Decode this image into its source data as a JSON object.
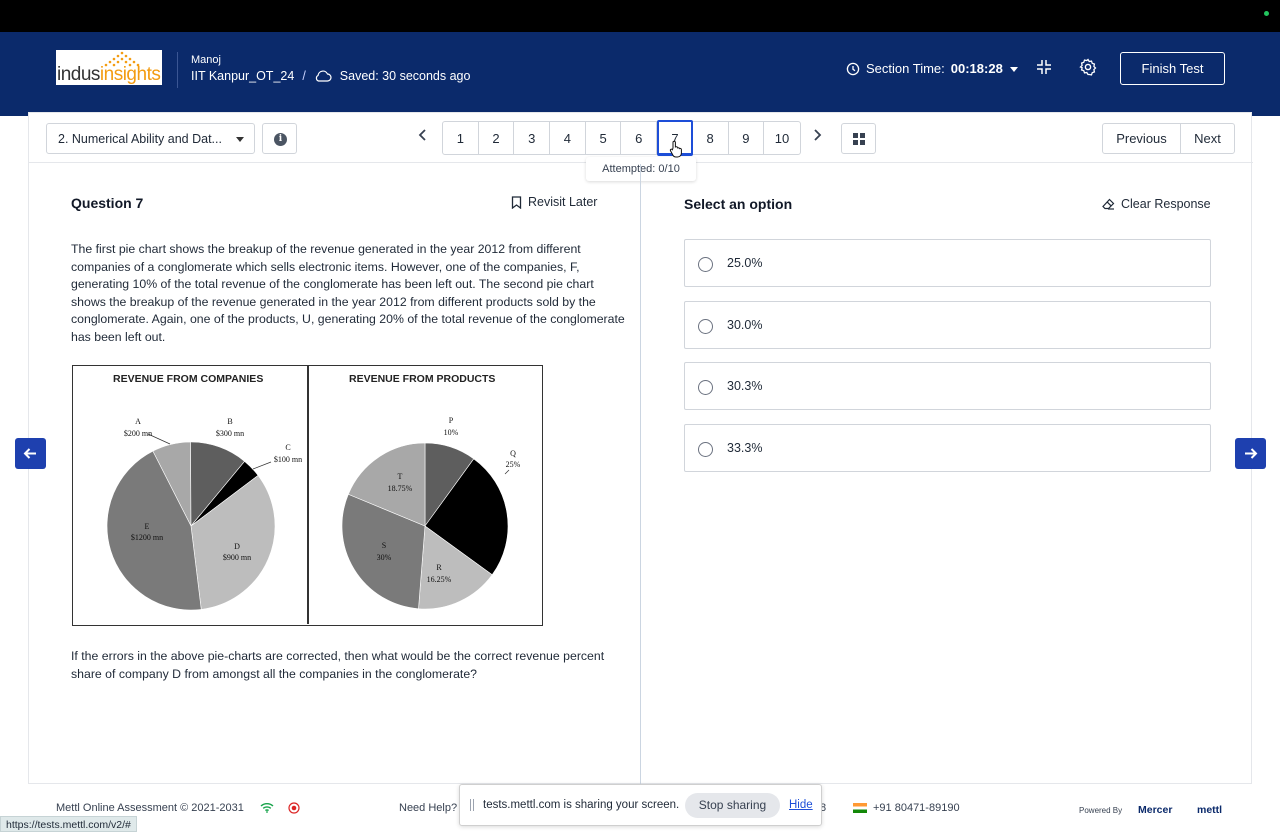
{
  "header": {
    "logo_text_a": "indus",
    "logo_text_b": "insights",
    "user_name": "Manoj",
    "test_name": "IIT Kanpur_OT_24",
    "separator": "/",
    "saved_status": "Saved: 30 seconds ago",
    "section_time_label": "Section Time:",
    "section_time_value": "00:18:28",
    "finish_label": "Finish Test"
  },
  "toolbar": {
    "section_select": "2. Numerical Ability and Dat...",
    "question_numbers": [
      "1",
      "2",
      "3",
      "4",
      "5",
      "6",
      "7",
      "8",
      "9",
      "10"
    ],
    "active_question": "7",
    "attempted": "Attempted: 0/10",
    "previous_label": "Previous",
    "next_label": "Next"
  },
  "question": {
    "title": "Question 7",
    "revisit_label": "Revisit Later",
    "text": "The first pie chart shows the breakup of the revenue generated in the year 2012 from different companies of a conglomerate which sells electronic items. However, one of the companies, F, generating 10% of the total revenue of the conglomerate has been left out. The second pie chart shows the breakup of the revenue generated in the year 2012 from different products sold by the conglomerate. Again, one of the products, U, generating 20% of the total revenue of the conglomerate has been left out.",
    "ask": "If the errors in the above pie-charts are corrected, then what would be the correct revenue percent share of company D from amongst all the companies in the conglomerate?"
  },
  "chart_data": [
    {
      "type": "pie",
      "title": "REVENUE FROM COMPANIES",
      "labels": [
        "A",
        "B",
        "C",
        "D",
        "E"
      ],
      "value_labels": [
        "$200 mn",
        "$300 mn",
        "$100 mn",
        "$900 mn",
        "$1200 mn"
      ],
      "values": [
        200,
        300,
        100,
        900,
        1200
      ],
      "colors": [
        "#a8a8a8",
        "#5e5e5e",
        "#000000",
        "#bdbdbd",
        "#7a7a7a"
      ]
    },
    {
      "type": "pie",
      "title": "REVENUE FROM PRODUCTS",
      "labels": [
        "P",
        "Q",
        "R",
        "S",
        "T"
      ],
      "value_labels": [
        "10%",
        "25%",
        "16.25%",
        "30%",
        "18.75%"
      ],
      "values": [
        10,
        25,
        16.25,
        30,
        18.75
      ],
      "colors": [
        "#5e5e5e",
        "#000000",
        "#bdbdbd",
        "#7a7a7a",
        "#a8a8a8"
      ]
    }
  ],
  "answers": {
    "title": "Select an option",
    "clear_label": "Clear Response",
    "options": [
      "25.0%",
      "30.0%",
      "30.3%",
      "33.3%"
    ]
  },
  "footer": {
    "copyright": "Mettl Online Assessment © 2021-2031",
    "help": "Need Help?",
    "partial": "8",
    "phone": "+91 80471-89190",
    "powered_by": "Powered By",
    "mercer": "Mercer",
    "mettl": "mettl",
    "share_message": "tests.mettl.com is sharing your screen.",
    "stop_sharing": "Stop sharing",
    "hide": "Hide",
    "status_url": "https://tests.mettl.com/v2/#"
  }
}
